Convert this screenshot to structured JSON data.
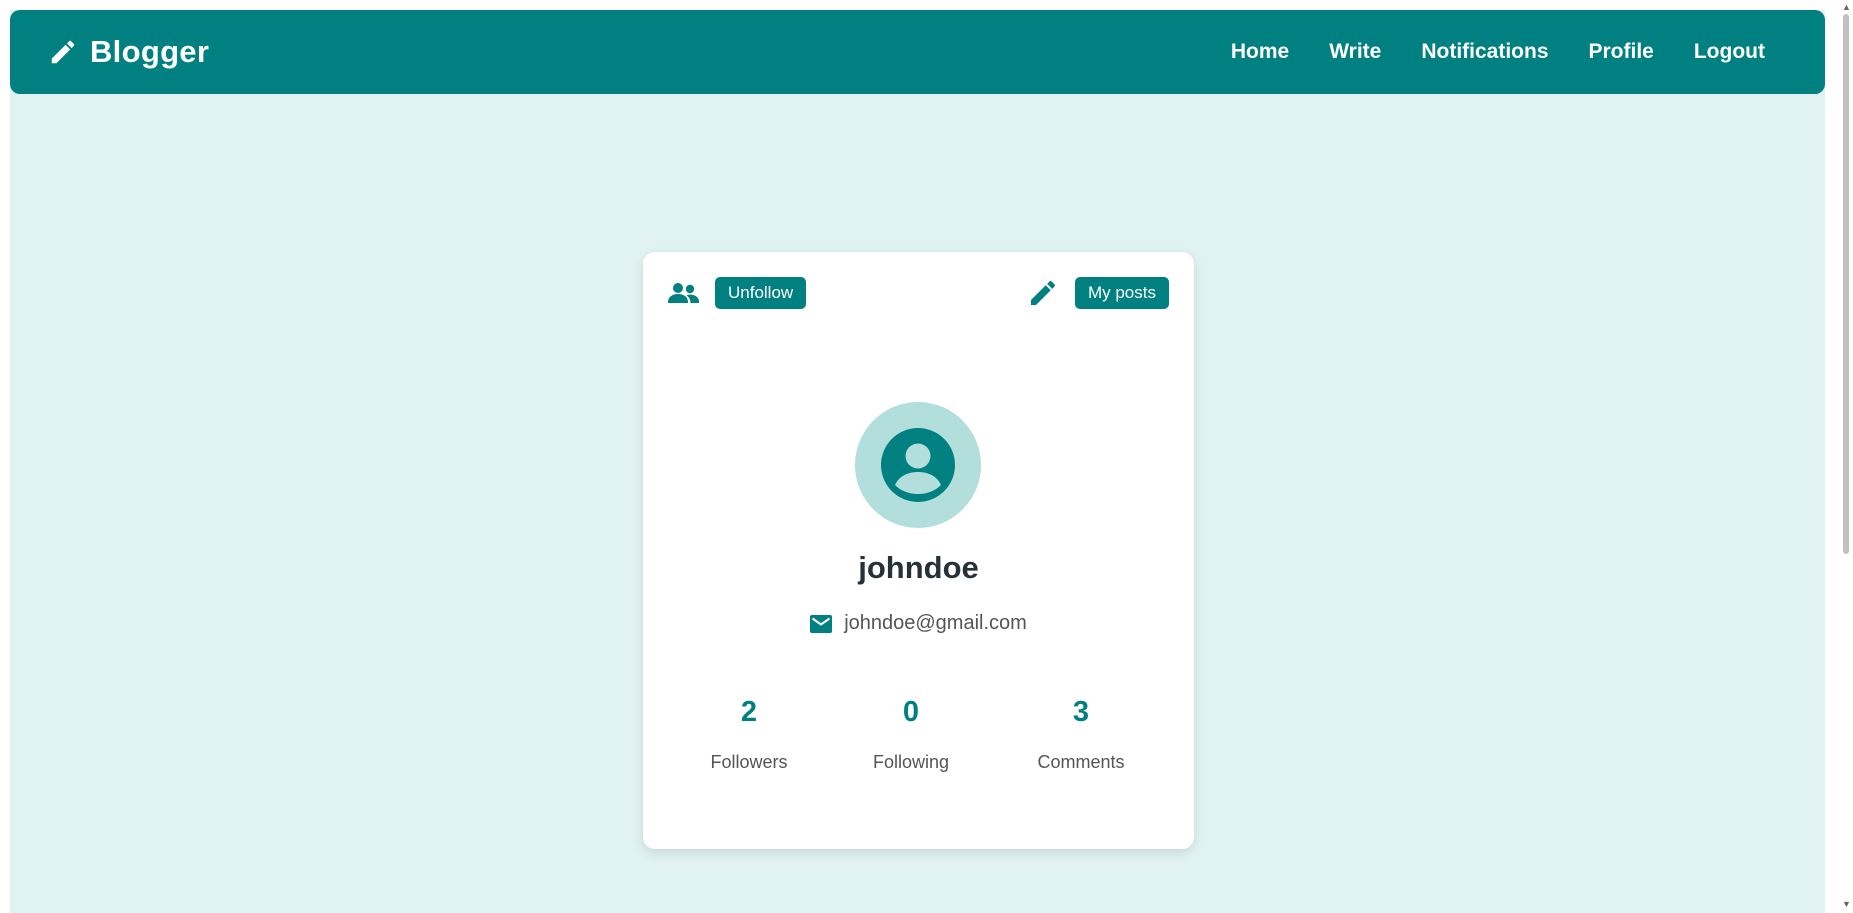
{
  "app": {
    "brand": "Blogger",
    "brand_icon": "pencil-icon",
    "accent_color": "#008080",
    "background_color": "#e0f2f1"
  },
  "nav": {
    "items": [
      {
        "label": "Home"
      },
      {
        "label": "Write"
      },
      {
        "label": "Notifications"
      },
      {
        "label": "Profile"
      },
      {
        "label": "Logout"
      }
    ]
  },
  "profile": {
    "follow_icon": "users-icon",
    "unfollow_label": "Unfollow",
    "posts_icon": "pencil-icon",
    "my_posts_label": "My posts",
    "avatar_icon": "user-circle-icon",
    "username": "johndoe",
    "email_icon": "envelope-icon",
    "email": "johndoe@gmail.com",
    "stats": [
      {
        "value": "2",
        "label": "Followers"
      },
      {
        "value": "0",
        "label": "Following"
      },
      {
        "value": "3",
        "label": "Comments"
      }
    ]
  }
}
